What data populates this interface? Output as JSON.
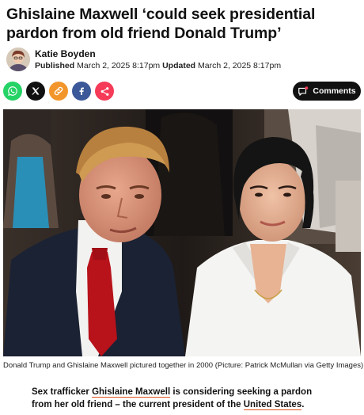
{
  "article": {
    "headline": "Ghislaine Maxwell ‘could seek presidential pardon from old friend Donald Trump’",
    "author": "Katie Boyden",
    "published_label": "Published",
    "published_date": "March 2, 2025 8:17pm",
    "updated_label": "Updated",
    "updated_date": "March 2, 2025 8:17pm"
  },
  "share": {
    "icons": [
      "whatsapp-icon",
      "x-icon",
      "link-icon",
      "facebook-icon",
      "share-icon"
    ],
    "colors": {
      "whatsapp": "#25d366",
      "x": "#111111",
      "link": "#f2962b",
      "facebook": "#3b5998",
      "share": "#f53b57"
    },
    "comments_label": "Comments",
    "comments_dot_color": "#f53b57"
  },
  "photo": {
    "caption": "Donald Trump and Ghislaine Maxwell pictured together in 2000 (Picture: Patrick McMullan via Getty Images)"
  },
  "lead": {
    "text_1": "Sex trafficker ",
    "link_1": "Ghislaine Maxwell",
    "text_2": " is considering seeking a pardon from her old friend – the current president of the ",
    "link_2": "United States",
    "text_3": ".",
    "link_underline_color": "#e0521c"
  }
}
